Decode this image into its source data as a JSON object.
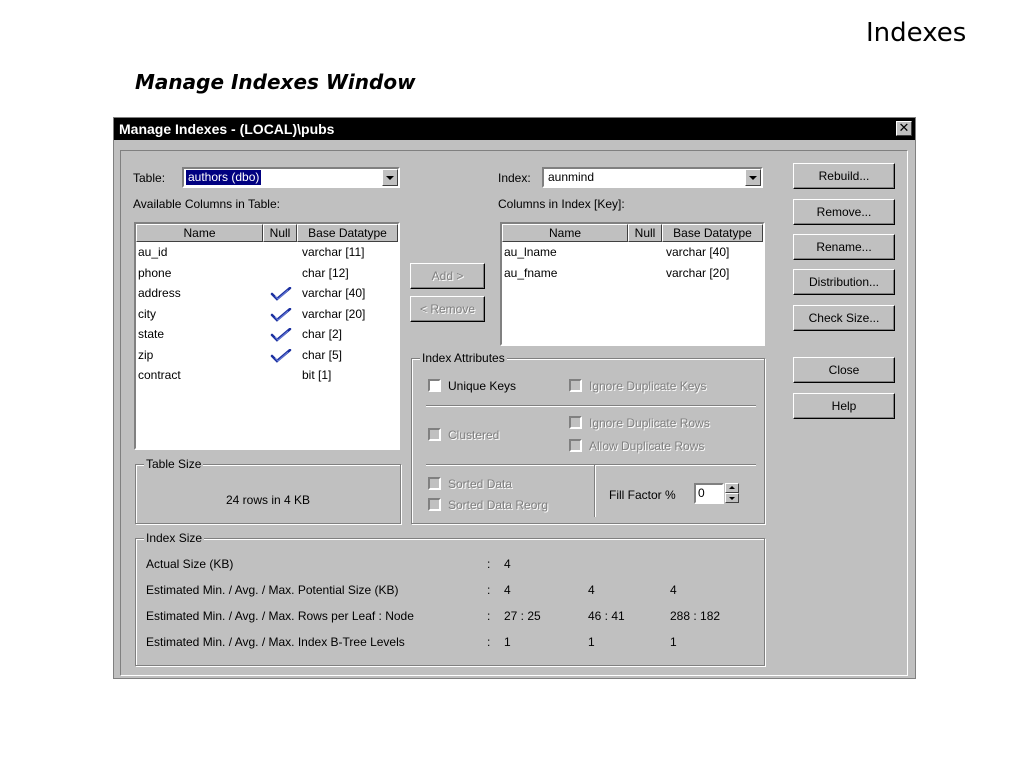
{
  "slide": {
    "title": "Indexes",
    "subtitle": "Manage Indexes Window"
  },
  "window": {
    "title": "Manage Indexes - (LOCAL)\\pubs",
    "close_label": "✕"
  },
  "table_section": {
    "label": "Table:",
    "selected": "authors (dbo)",
    "available_label": "Available Columns in Table:",
    "headers": [
      "Name",
      "Null",
      "Base Datatype"
    ],
    "rows": [
      {
        "name": "au_id",
        "null": false,
        "type": "varchar [11]"
      },
      {
        "name": "phone",
        "null": false,
        "type": "char [12]"
      },
      {
        "name": "address",
        "null": true,
        "type": "varchar [40]"
      },
      {
        "name": "city",
        "null": true,
        "type": "varchar [20]"
      },
      {
        "name": "state",
        "null": true,
        "type": "char [2]"
      },
      {
        "name": "zip",
        "null": true,
        "type": "char [5]"
      },
      {
        "name": "contract",
        "null": false,
        "type": "bit [1]"
      }
    ]
  },
  "index_section": {
    "label": "Index:",
    "selected": "aunmind",
    "columns_label": "Columns in Index [Key]:",
    "headers": [
      "Name",
      "Null",
      "Base Datatype"
    ],
    "rows": [
      {
        "name": "au_lname",
        "null": false,
        "type": "varchar [40]"
      },
      {
        "name": "au_fname",
        "null": false,
        "type": "varchar [20]"
      }
    ]
  },
  "middle_buttons": {
    "add": "Add >",
    "remove": "< Remove"
  },
  "right_buttons": {
    "rebuild": "Rebuild...",
    "remove": "Remove...",
    "rename": "Rename...",
    "distribution": "Distribution...",
    "check_size": "Check Size...",
    "close": "Close",
    "help": "Help"
  },
  "index_attributes": {
    "title": "Index Attributes",
    "unique_keys": "Unique Keys",
    "ignore_dup_keys": "Ignore Duplicate Keys",
    "clustered": "Clustered",
    "ignore_dup_rows": "Ignore Duplicate Rows",
    "allow_dup_rows": "Allow Duplicate Rows",
    "sorted_data": "Sorted Data",
    "sorted_data_reorg": "Sorted Data Reorg",
    "fill_factor_label": "Fill Factor %",
    "fill_factor_value": "0"
  },
  "table_size": {
    "title": "Table Size",
    "text": "24 rows in 4 KB"
  },
  "index_size": {
    "title": "Index Size",
    "rows": [
      {
        "label": "Actual Size (KB)",
        "colon": ":",
        "min": "4",
        "avg": "",
        "max": ""
      },
      {
        "label": "Estimated Min. / Avg. / Max. Potential Size (KB)",
        "colon": ":",
        "min": "4",
        "avg": "4",
        "max": "4"
      },
      {
        "label": "Estimated Min. / Avg. / Max. Rows per Leaf : Node",
        "colon": ":",
        "min": "27 : 25",
        "avg": "46 : 41",
        "max": "288 : 182"
      },
      {
        "label": "Estimated Min. / Avg. / Max. Index B-Tree Levels",
        "colon": ":",
        "min": "1",
        "avg": "1",
        "max": "1"
      }
    ]
  },
  "colors": {
    "title_bar": "#000000",
    "dialog_face": "#c0c0c0",
    "selection": "#000080",
    "checkmark": "#1a2fa0"
  }
}
